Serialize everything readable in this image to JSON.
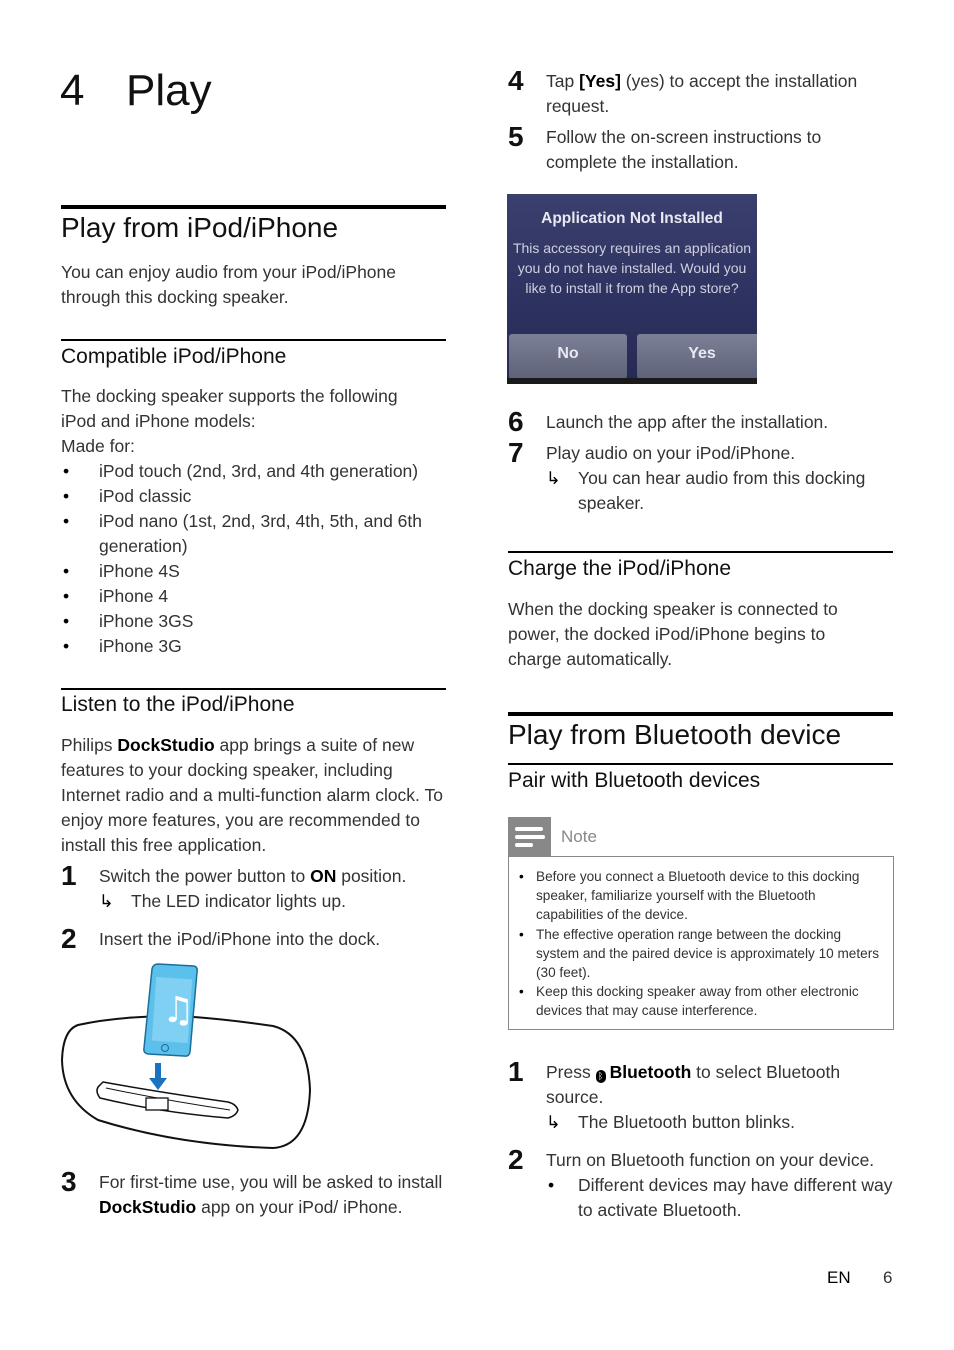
{
  "chapter": {
    "number": "4",
    "title": "Play"
  },
  "section_ipod": {
    "title": "Play from iPod/iPhone",
    "intro": "You can enjoy audio from your iPod/iPhone through this docking speaker."
  },
  "compatible": {
    "title": "Compatible iPod/iPhone",
    "intro": "The docking speaker supports the following iPod and iPhone models:",
    "made_for": "Made for:",
    "models": [
      "iPod touch (2nd, 3rd, and 4th generation)",
      "iPod classic",
      "iPod nano (1st, 2nd, 3rd, 4th, 5th, and 6th generation)",
      "iPhone 4S",
      "iPhone 4",
      "iPhone 3GS",
      "iPhone 3G"
    ]
  },
  "listen": {
    "title": "Listen to the iPod/iPhone",
    "intro_pre": "Philips ",
    "intro_bold": "DockStudio",
    "intro_post": " app brings a suite of new features to your docking speaker, including Internet radio and a multi-function alarm clock. To enjoy more features, you are recommended to install this free application.",
    "steps": [
      {
        "num": "1",
        "pre": "Switch the power button to ",
        "bold": "ON",
        "post": " position.",
        "result": "The LED indicator lights up."
      },
      {
        "num": "2",
        "text": "Insert the iPod/iPhone into the dock."
      },
      {
        "num": "3",
        "pre": "For first-time use, you will be asked to install ",
        "bold": "DockStudio",
        "post": " app on your iPod/ iPhone."
      },
      {
        "num": "4",
        "pre": "Tap ",
        "bold": "[Yes]",
        "post": " (yes) to accept the installation request."
      },
      {
        "num": "5",
        "text": "Follow the on-screen instructions to complete the installation."
      },
      {
        "num": "6",
        "text": "Launch the app after the installation."
      },
      {
        "num": "7",
        "text": "Play audio on your iPod/iPhone.",
        "result": "You can hear audio from this docking speaker."
      }
    ]
  },
  "dialog": {
    "title": "Application Not Installed",
    "message": "This accessory requires an application you do not have installed. Would you like to install it from the App store?",
    "no_label": "No",
    "yes_label": "Yes"
  },
  "charge": {
    "title": "Charge the iPod/iPhone",
    "text": "When the docking speaker is connected to power, the docked iPod/iPhone begins to charge automatically."
  },
  "bluetooth": {
    "title": "Play from Bluetooth device",
    "pair_title": "Pair with Bluetooth devices",
    "note_label": "Note",
    "notes": [
      "Before you connect a Bluetooth device to this docking speaker, familiarize yourself with the Bluetooth capabilities of the device.",
      "The effective operation range between the docking system and the paired device is approximately 10 meters (30 feet).",
      "Keep this docking speaker away from other electronic devices that may cause interference."
    ],
    "steps": [
      {
        "num": "1",
        "pre": "Press ",
        "bold": "Bluetooth",
        "post": " to select Bluetooth source.",
        "result": "The Bluetooth button blinks."
      },
      {
        "num": "2",
        "text": "Turn on Bluetooth function on your device.",
        "bullet": "Different devices may have different way to activate Bluetooth."
      }
    ]
  },
  "footer": {
    "lang": "EN",
    "page": "6"
  },
  "colors": {
    "phone_blue": "#5bc0eb",
    "arrow_blue": "#1a73c2",
    "note_gray": "#888888"
  }
}
